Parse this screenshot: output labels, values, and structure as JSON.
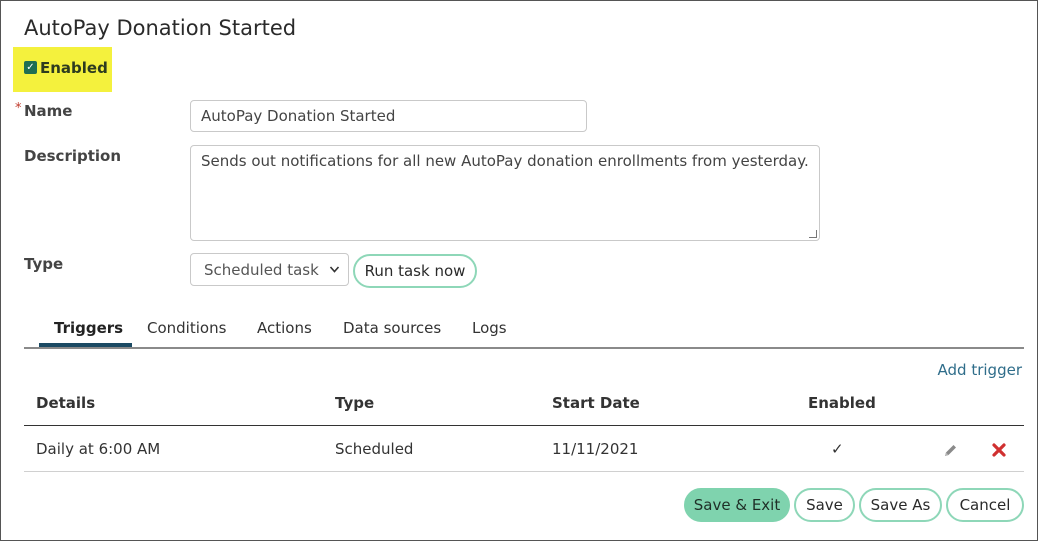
{
  "page": {
    "title": "AutoPay Donation Started"
  },
  "enabled": {
    "label": "Enabled",
    "checked": true,
    "check_glyph": "✓",
    "highlight_color": "#f4f13d"
  },
  "form": {
    "name_label": "Name",
    "required_marker": "*",
    "name_value": "AutoPay Donation Started",
    "description_label": "Description",
    "description_value": "Sends out notifications for all new AutoPay donation enrollments from yesterday.",
    "type_label": "Type",
    "type_selected": "Scheduled task",
    "run_task_label": "Run task now"
  },
  "tabs": [
    {
      "label": "Triggers",
      "active": true
    },
    {
      "label": "Conditions",
      "active": false
    },
    {
      "label": "Actions",
      "active": false
    },
    {
      "label": "Data sources",
      "active": false
    },
    {
      "label": "Logs",
      "active": false
    }
  ],
  "triggers": {
    "add_label": "Add trigger",
    "columns": [
      "Details",
      "Type",
      "Start Date",
      "Enabled"
    ],
    "rows": [
      {
        "details": "Daily at 6:00 AM",
        "type": "Scheduled",
        "start_date": "11/11/2021",
        "enabled": "✓",
        "edit_icon": "pencil-icon",
        "delete_icon": "delete-x-icon"
      }
    ]
  },
  "footer": {
    "save_exit_label": "Save & Exit",
    "save_label": "Save",
    "save_as_label": "Save As",
    "cancel_label": "Cancel"
  },
  "colors": {
    "accent_green": "#7fd3ae",
    "outline_green": "#8ed7b8",
    "link_blue": "#2f6d8a",
    "tab_underline": "#1b4a63",
    "delete_red": "#d03030"
  }
}
